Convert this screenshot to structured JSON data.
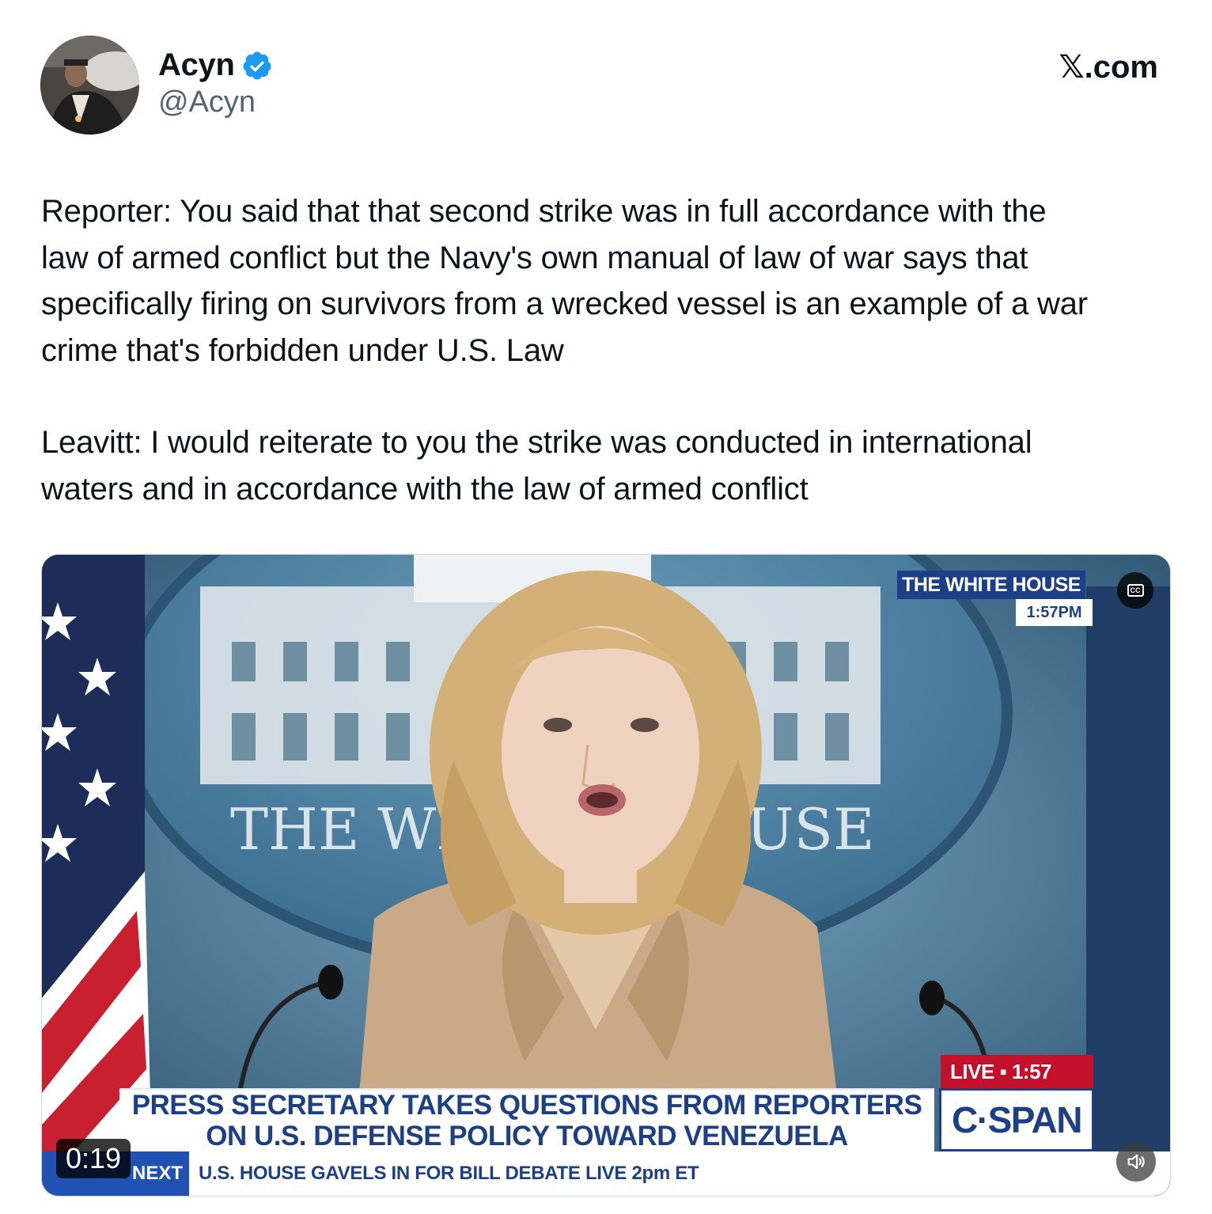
{
  "author": {
    "name": "Acyn",
    "handle": "@Acyn",
    "verified": true
  },
  "brand": "𝕏.com",
  "tweet": {
    "reporter_text": "Reporter: You said that that second strike was in full accordance with the\nlaw of armed conflict but the Navy's own manual of law of war says that\nspecifically firing on survivors from a wrecked vessel is an example of a war\ncrime that's forbidden under U.S. Law",
    "leavitt_text": "Leavitt: I would reiterate to you the strike was conducted in international\nwaters and in accordance with the law of armed conflict"
  },
  "video": {
    "bug_title": "THE WHITE HOUSE",
    "bug_time": "1:57PM",
    "backdrop_text_left": "THE WH",
    "backdrop_text_right": "USE",
    "cc_label": "CC",
    "live_label": "LIVE ▪ 1:57",
    "network": "C·SPAN",
    "headline_line1": "PRESS SECRETARY TAKES QUESTIONS FROM REPORTERS",
    "headline_line2": "ON U.S. DEFENSE POLICY TOWARD VENEZUELA",
    "next_label": "NEXT",
    "next_text": "U.S. HOUSE GAVELS IN FOR BILL DEBATE LIVE 2pm ET",
    "timestamp": "0:19"
  },
  "colors": {
    "verified_blue": "#1d9bf0",
    "cspan_blue": "#1d3f86",
    "live_red": "#c5102b",
    "handle_gray": "#536471"
  },
  "icons": [
    "verified-badge-icon",
    "cc-icon",
    "volume-icon"
  ]
}
